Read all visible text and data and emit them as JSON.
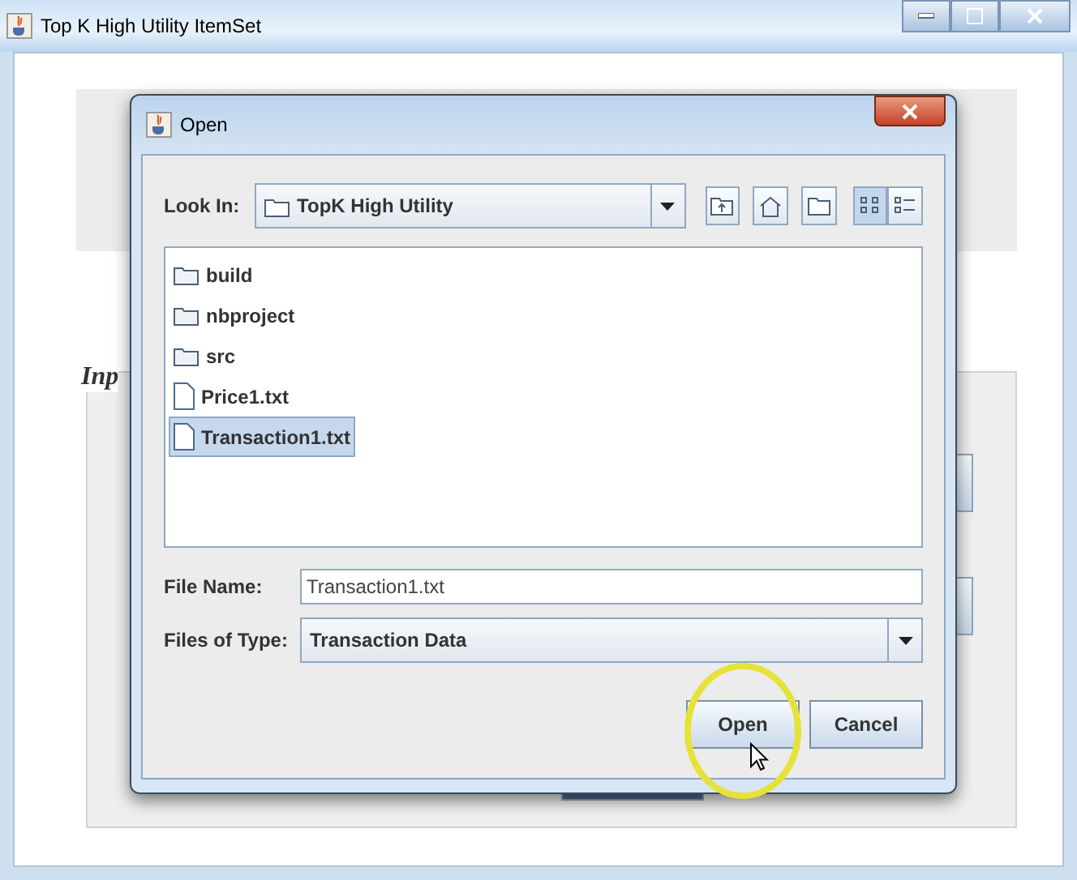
{
  "window": {
    "title": "Top K High Utility ItemSet"
  },
  "background": {
    "legend": "Inp"
  },
  "dialog": {
    "title": "Open",
    "look_in": {
      "label": "Look In:",
      "value": "TopK High Utility"
    },
    "files": [
      {
        "name": "build",
        "kind": "folder",
        "selected": false
      },
      {
        "name": "nbproject",
        "kind": "folder",
        "selected": false
      },
      {
        "name": "src",
        "kind": "folder",
        "selected": false
      },
      {
        "name": "Price1.txt",
        "kind": "file",
        "selected": false
      },
      {
        "name": "Transaction1.txt",
        "kind": "file",
        "selected": true
      }
    ],
    "file_name": {
      "label": "File Name:",
      "value": "Transaction1.txt"
    },
    "file_type": {
      "label": "Files of Type:",
      "value": "Transaction Data"
    },
    "buttons": [
      "Open",
      "Cancel"
    ]
  }
}
